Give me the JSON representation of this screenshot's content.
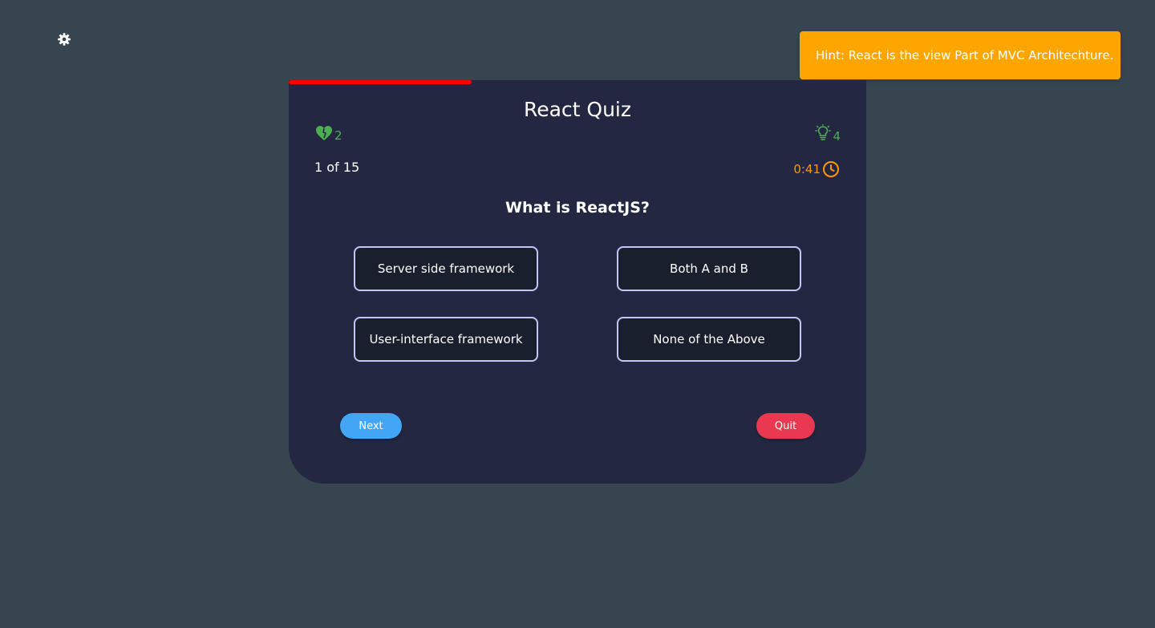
{
  "settings": {
    "icon": "gear-icon"
  },
  "toast": {
    "text": "Hint: React is the view Part of MVC Architechture."
  },
  "quiz": {
    "title": "React Quiz",
    "progress_fraction": 0.317,
    "lifelines": {
      "icon": "heart-icon",
      "count": "2"
    },
    "hints": {
      "icon": "lightbulb-icon",
      "count": "4"
    },
    "counter": "1 of 15",
    "timer": {
      "value": "0:41",
      "icon": "clock-icon"
    },
    "question": "What is ReactJS?",
    "options": [
      "Server side framework",
      "Both A and B",
      "User-interface framework",
      "None of the Above"
    ],
    "buttons": {
      "next": "Next",
      "quit": "Quit"
    }
  },
  "colors": {
    "background": "#36454f",
    "card": "#232741",
    "toast": "#ffa500",
    "progress": "#ff0000",
    "lifeline": "#4caf50",
    "timer": "#ff9800",
    "next_button": "#42a5f5",
    "quit_button": "#e9384f",
    "option_border": "#c5c5f5"
  }
}
